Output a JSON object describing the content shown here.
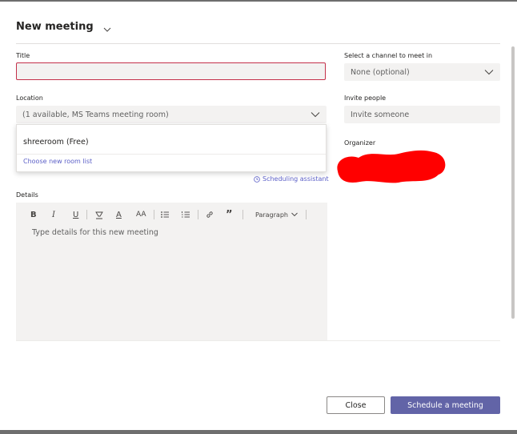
{
  "header": {
    "title": "New meeting"
  },
  "form": {
    "title_label": "Title",
    "title_value": "",
    "location_label": "Location",
    "location_value": "(1 available, MS Teams meeting room)",
    "location_options": [
      {
        "label": "shreeroom (Free)"
      }
    ],
    "location_link": "Choose new room list",
    "scheduling_assistant": "Scheduling assistant",
    "details_label": "Details",
    "details_placeholder": "Type details for this new meeting",
    "channel_label": "Select a channel to meet in",
    "channel_value": "None (optional)",
    "invite_label": "Invite people",
    "invite_placeholder": "Invite someone",
    "organizer_label": "Organizer"
  },
  "toolbar": {
    "bold": "B",
    "italic": "I",
    "underline": "U",
    "font_color": "A",
    "font_size": "AA",
    "quote": "”",
    "paragraph": "Paragraph"
  },
  "footer": {
    "close_label": "Close",
    "schedule_label": "Schedule a meeting"
  },
  "colors": {
    "accent": "#6264a7",
    "link": "#5b5fc7",
    "error_border": "#c4314b",
    "redaction": "#ff0000"
  }
}
